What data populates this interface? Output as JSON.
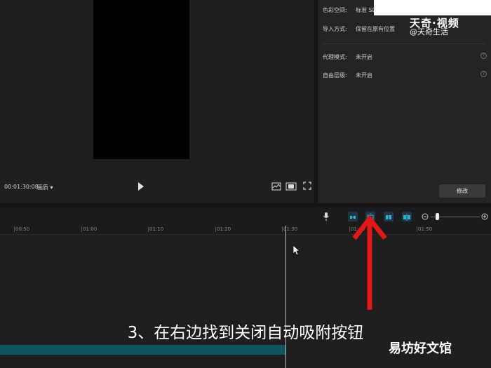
{
  "preview": {
    "timecode": "00:01:30:08",
    "ratio_label": "画质",
    "ratio_arrow": "▾"
  },
  "props": {
    "rows": [
      {
        "label": "色彩空间:",
        "value": "标准 SD"
      },
      {
        "label": "导入方式:",
        "value": "保留在原有位置"
      },
      {
        "label": "代理模式:",
        "value": "未开启"
      },
      {
        "label": "自由层级:",
        "value": "未开启"
      }
    ],
    "modify_label": "修改"
  },
  "watermark": {
    "line1": "天奇·视频",
    "line2": "@天奇生活"
  },
  "timeline": {
    "ticks": [
      "00:50",
      "01:00",
      "01:10",
      "01:20",
      "01:30",
      "01:40",
      "01:50"
    ]
  },
  "caption": "3、在右边找到关闭自动吸附按钮",
  "corner_watermark": "易坊好文馆",
  "colors": {
    "accent": "#2bb5d0",
    "clip": "#11535e",
    "arrow": "#e01818"
  },
  "icons": [
    "play-icon",
    "waveform-icon",
    "ratio-icon",
    "fullscreen-icon",
    "microphone-icon",
    "link-icon",
    "magnet-icon",
    "split-icon",
    "align-icon",
    "zoom-out-icon",
    "zoom-in-icon",
    "help-icon",
    "mouse-cursor-icon",
    "red-arrow-icon"
  ]
}
